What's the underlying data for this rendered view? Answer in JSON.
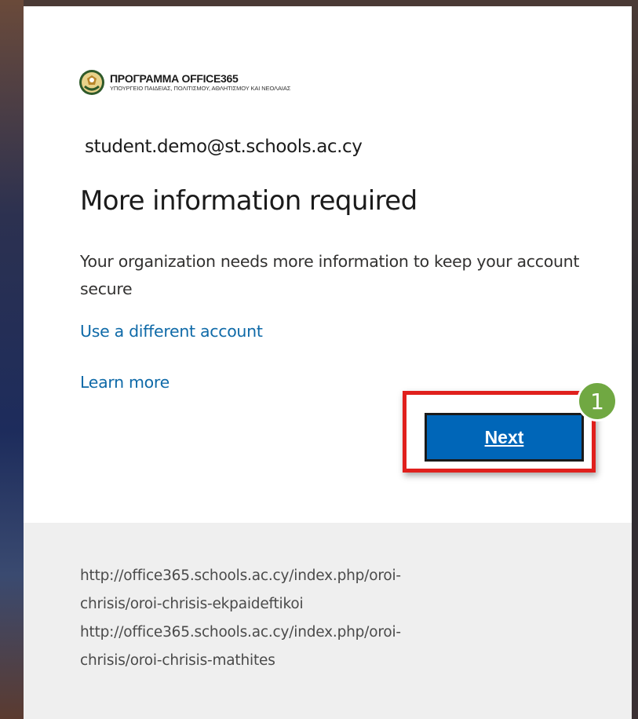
{
  "header": {
    "logo_title": "ΠΡΟΓΡΑΜΜΑ OFFICE365",
    "logo_subtitle": "ΥΠΟΥΡΓΕΙΟ ΠΑΙΔΕΙΑΣ, ΠΟΛΙΤΙΣΜΟΥ, ΑΘΛΗΤΙΣΜΟΥ ΚΑΙ ΝΕΟΛΑΙΑΣ",
    "logo_icon": "crest-icon"
  },
  "account": {
    "email": "student.demo@st.schools.ac.cy"
  },
  "main": {
    "heading": "More information required",
    "description": "Your organization needs more information to keep your account secure",
    "link_different_account": "Use a different account",
    "link_learn_more": "Learn more",
    "next_label": "Next"
  },
  "annotation": {
    "step_number": "1"
  },
  "footer": {
    "lines": [
      "http://office365.schools.ac.cy/index.php/oroi-",
      "chrisis/oroi-chrisis-ekpaideftikoi",
      "http://office365.schools.ac.cy/index.php/oroi-",
      "chrisis/oroi-chrisis-mathites"
    ]
  },
  "colors": {
    "link": "#0f6aa8",
    "button": "#0066b8",
    "highlight": "#e0201d",
    "badge": "#70a842",
    "footer_bg": "#efefef"
  }
}
